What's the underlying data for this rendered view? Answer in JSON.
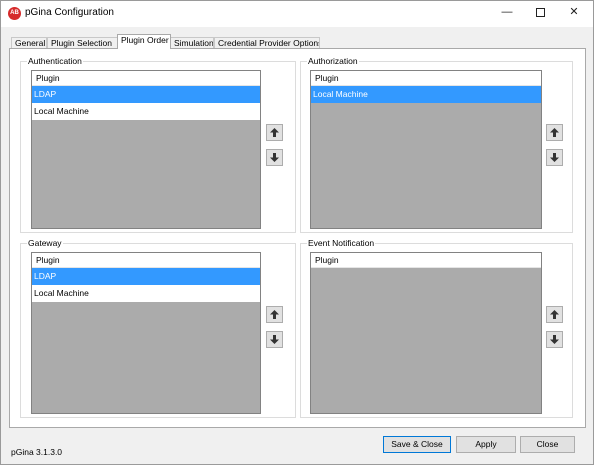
{
  "window": {
    "title": "pGina Configuration",
    "icon_glyph": "AB",
    "minimize_glyph": "—",
    "close_glyph": "✕"
  },
  "tabs": [
    {
      "label": "General",
      "active": false
    },
    {
      "label": "Plugin Selection",
      "active": false
    },
    {
      "label": "Plugin Order",
      "active": true
    },
    {
      "label": "Simulation",
      "active": false
    },
    {
      "label": "Credential Provider Options",
      "active": false
    }
  ],
  "groups": {
    "authentication": {
      "label": "Authentication",
      "header": "Plugin",
      "rows": [
        {
          "label": "LDAP",
          "selected": true
        },
        {
          "label": "Local Machine",
          "selected": false
        }
      ]
    },
    "authorization": {
      "label": "Authorization",
      "header": "Plugin",
      "rows": [
        {
          "label": "Local Machine",
          "selected": true
        }
      ]
    },
    "gateway": {
      "label": "Gateway",
      "header": "Plugin",
      "rows": [
        {
          "label": "LDAP",
          "selected": true
        },
        {
          "label": "Local Machine",
          "selected": false
        }
      ]
    },
    "event_notification": {
      "label": "Event Notification",
      "header": "Plugin",
      "rows": []
    }
  },
  "icons": {
    "move_up": "arrow-up-icon",
    "move_down": "arrow-down-icon"
  },
  "footer": {
    "version": "pGina 3.1.3.0",
    "save_close_label": "Save & Close",
    "apply_label": "Apply",
    "close_label": "Close"
  },
  "colors": {
    "selection": "#3399ff",
    "list_empty": "#ababab",
    "app_icon": "#d62b2b"
  }
}
